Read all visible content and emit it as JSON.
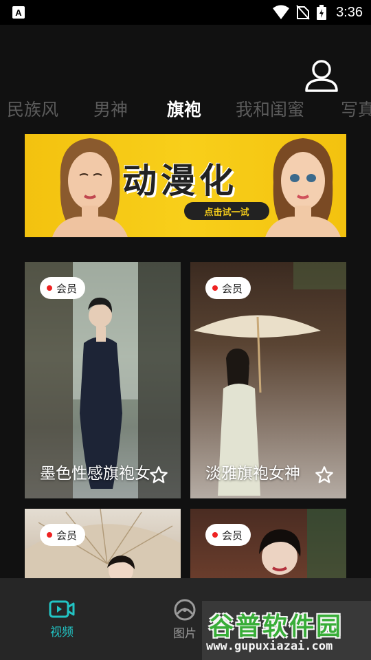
{
  "status_bar": {
    "time": "3:36",
    "icons": [
      "app-notification-icon",
      "wifi-icon",
      "no-sim-icon",
      "battery-icon"
    ]
  },
  "tabs": [
    {
      "label": "民族风",
      "active": false
    },
    {
      "label": "男神",
      "active": false
    },
    {
      "label": "旗袍",
      "active": true
    },
    {
      "label": "我和闺蜜",
      "active": false
    },
    {
      "label": "写真",
      "active": false
    }
  ],
  "banner": {
    "title": "动漫化",
    "button": "点击试一试"
  },
  "cards": [
    {
      "badge": "会员",
      "title": "墨色性感旗袍女"
    },
    {
      "badge": "会员",
      "title": "淡雅旗袍女神"
    },
    {
      "badge": "会员",
      "title": ""
    },
    {
      "badge": "会员",
      "title": ""
    }
  ],
  "bottom_nav": [
    {
      "label": "视频",
      "active": true
    },
    {
      "label": "图片",
      "active": false
    }
  ],
  "watermark": {
    "title": "谷普软件园",
    "url": "www.gupuxiazai.com"
  },
  "colors": {
    "accent": "#22c4c4",
    "background": "#111111",
    "badge_dot": "#ee2222"
  }
}
